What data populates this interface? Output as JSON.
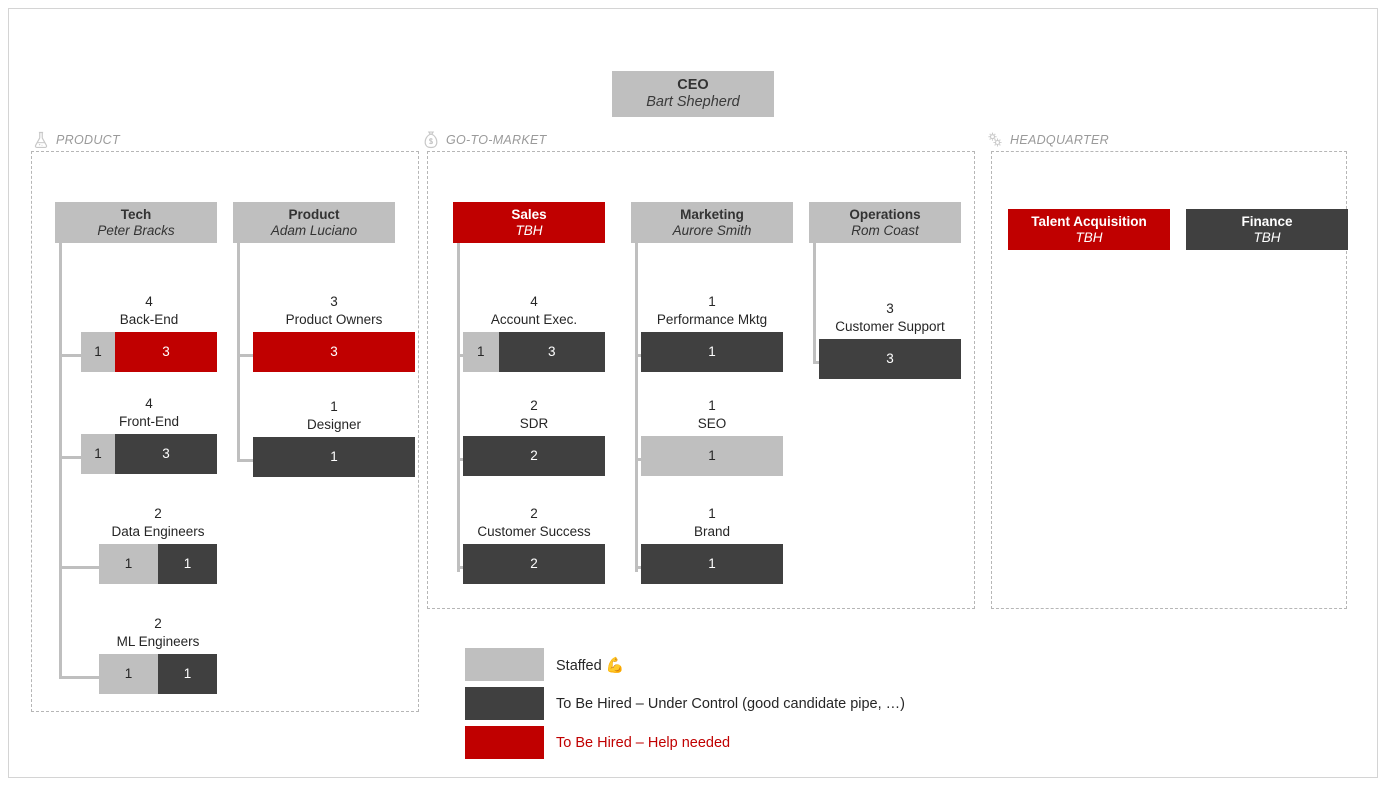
{
  "ceo": {
    "title": "CEO",
    "name": "Bart Shepherd"
  },
  "zones": [
    {
      "key": "product",
      "label": "PRODUCT",
      "icon": "flask-icon"
    },
    {
      "key": "gotomarket",
      "label": "GO-TO-MARKET",
      "icon": "money-bag-icon"
    },
    {
      "key": "headquarter",
      "label": "HEADQUARTER",
      "icon": "gears-icon"
    }
  ],
  "departments": [
    {
      "key": "tech",
      "title": "Tech",
      "name": "Peter Bracks",
      "header_style": "gray",
      "roles": [
        {
          "count": "4",
          "label": "Back-End",
          "segments": [
            {
              "value": "1",
              "style": "staffed"
            },
            {
              "value": "3",
              "style": "help"
            }
          ]
        },
        {
          "count": "4",
          "label": "Front-End",
          "segments": [
            {
              "value": "1",
              "style": "staffed"
            },
            {
              "value": "3",
              "style": "tbh"
            }
          ]
        },
        {
          "count": "2",
          "label": "Data Engineers",
          "segments": [
            {
              "value": "1",
              "style": "staffed"
            },
            {
              "value": "1",
              "style": "tbh"
            }
          ]
        },
        {
          "count": "2",
          "label": "ML Engineers",
          "segments": [
            {
              "value": "1",
              "style": "staffed"
            },
            {
              "value": "1",
              "style": "tbh"
            }
          ]
        }
      ]
    },
    {
      "key": "product",
      "title": "Product",
      "name": "Adam Luciano",
      "header_style": "gray",
      "roles": [
        {
          "count": "3",
          "label": "Product Owners",
          "segments": [
            {
              "value": "3",
              "style": "help"
            }
          ]
        },
        {
          "count": "1",
          "label": "Designer",
          "segments": [
            {
              "value": "1",
              "style": "tbh"
            }
          ]
        }
      ]
    },
    {
      "key": "sales",
      "title": "Sales",
      "name": "TBH",
      "header_style": "red",
      "roles": [
        {
          "count": "4",
          "label": "Account Exec.",
          "segments": [
            {
              "value": "1",
              "style": "staffed"
            },
            {
              "value": "3",
              "style": "tbh"
            }
          ]
        },
        {
          "count": "2",
          "label": "SDR",
          "segments": [
            {
              "value": "2",
              "style": "tbh"
            }
          ]
        },
        {
          "count": "2",
          "label": "Customer Success",
          "segments": [
            {
              "value": "2",
              "style": "tbh"
            }
          ]
        }
      ]
    },
    {
      "key": "marketing",
      "title": "Marketing",
      "name": "Aurore Smith",
      "header_style": "gray",
      "roles": [
        {
          "count": "1",
          "label": "Performance Mktg",
          "segments": [
            {
              "value": "1",
              "style": "tbh"
            }
          ]
        },
        {
          "count": "1",
          "label": "SEO",
          "segments": [
            {
              "value": "1",
              "style": "staffed"
            }
          ]
        },
        {
          "count": "1",
          "label": "Brand",
          "segments": [
            {
              "value": "1",
              "style": "tbh"
            }
          ]
        }
      ]
    },
    {
      "key": "operations",
      "title": "Operations",
      "name": "Rom Coast",
      "header_style": "gray",
      "roles": [
        {
          "count": "3",
          "label": "Customer Support",
          "segments": [
            {
              "value": "3",
              "style": "tbh"
            }
          ]
        }
      ]
    },
    {
      "key": "talent-acquisition",
      "title": "Talent Acquisition",
      "name": "TBH",
      "header_style": "red",
      "roles": []
    },
    {
      "key": "finance",
      "title": "Finance",
      "name": "TBH",
      "header_style": "dark",
      "roles": []
    }
  ],
  "legend": [
    {
      "style": "staffed",
      "text": "Staffed",
      "suffix_icon": "flexed-biceps-icon",
      "text_color": "#262626"
    },
    {
      "style": "tbh",
      "text": "To Be Hired – Under Control (good candidate pipe, …)",
      "text_color": "#262626"
    },
    {
      "style": "help",
      "text": "To Be Hired – Help needed",
      "text_color": "#c00000"
    }
  ],
  "colors": {
    "staffed": "#bfbfbf",
    "to_be_hired": "#404040",
    "help_needed": "#c00000",
    "zone_border": "#b6b6b6"
  }
}
